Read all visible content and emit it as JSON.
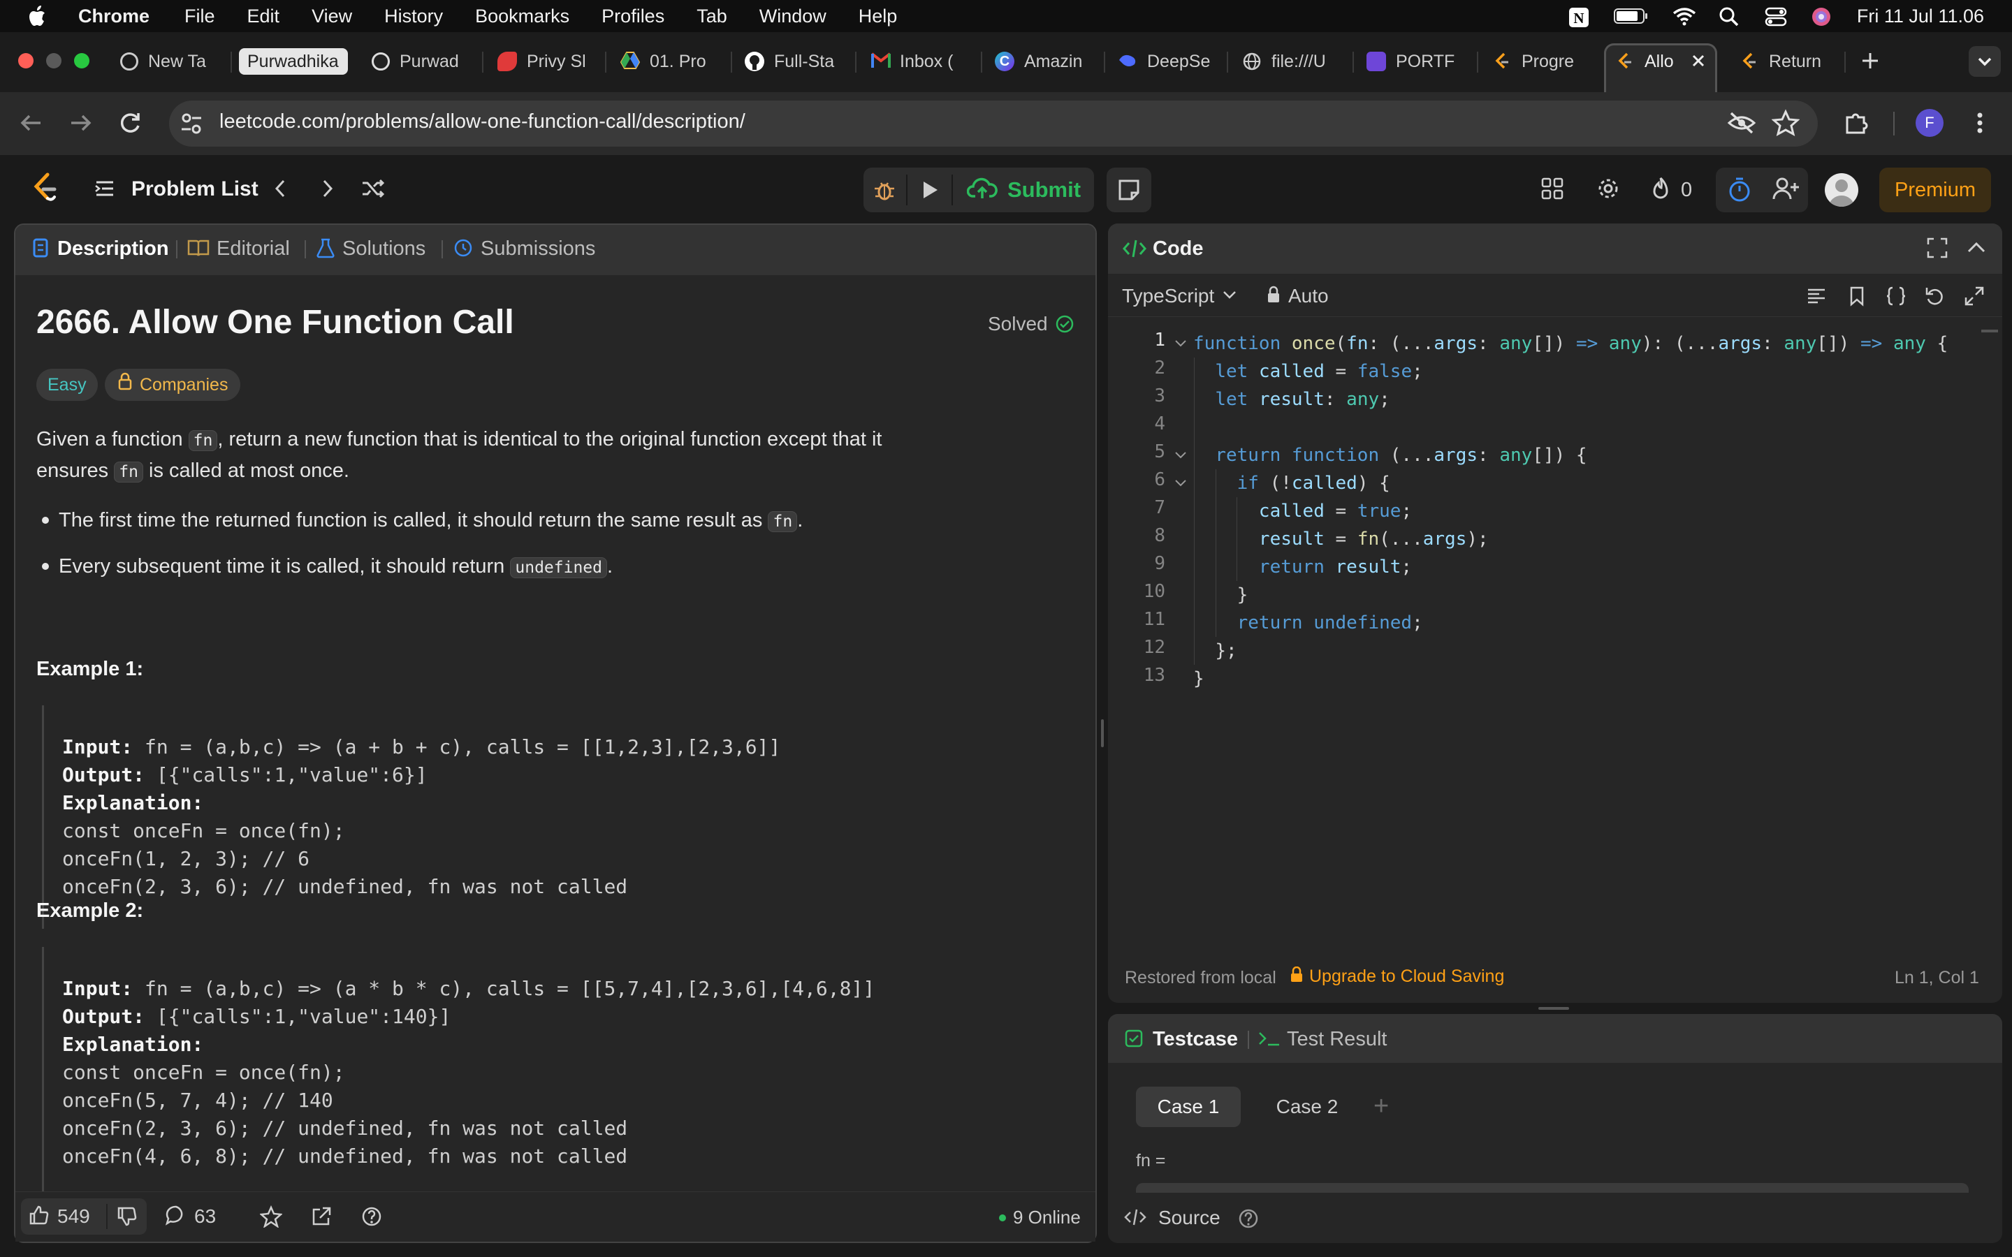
{
  "menubar": {
    "app_name": "Chrome",
    "items": [
      "File",
      "Edit",
      "View",
      "History",
      "Bookmarks",
      "Profiles",
      "Tab",
      "Window",
      "Help"
    ],
    "datetime": "Fri 11 Jul  11.06"
  },
  "tabs": [
    {
      "label": "New Ta",
      "icon": "chrome-icon"
    },
    {
      "label": "Purwadhika",
      "icon": "tab-group-chip"
    },
    {
      "label": "Purwad",
      "icon": "purwadhika-icon"
    },
    {
      "label": "Privy Sl",
      "icon": "privy-icon"
    },
    {
      "label": "01. Pro",
      "icon": "drive-icon"
    },
    {
      "label": "Full-Sta",
      "icon": "github-icon"
    },
    {
      "label": "Inbox (",
      "icon": "gmail-icon"
    },
    {
      "label": "Amazin",
      "icon": "canva-icon"
    },
    {
      "label": "DeepSe",
      "icon": "deepseek-icon"
    },
    {
      "label": "file:///U",
      "icon": "globe-icon"
    },
    {
      "label": "PORTF",
      "icon": "portfolio-icon"
    },
    {
      "label": "Progre",
      "icon": "leetcode-icon"
    },
    {
      "label": "Allo",
      "icon": "leetcode-icon"
    },
    {
      "label": "Return",
      "icon": "leetcode-icon"
    }
  ],
  "address": {
    "url": "leetcode.com/problems/allow-one-function-call/description/",
    "profile_initial": "F"
  },
  "lc_header": {
    "problem_list": "Problem List",
    "submit": "Submit",
    "streak": "0",
    "premium": "Premium"
  },
  "left_panel": {
    "tabs": [
      "Description",
      "Editorial",
      "Solutions",
      "Submissions"
    ],
    "title": "2666. Allow One Function Call",
    "status": "Solved",
    "difficulty": "Easy",
    "companies": "Companies",
    "para1_a": "Given a function ",
    "para1_code": "fn",
    "para1_b": ", return a new function that is identical to the original function except that it",
    "para2_a": "ensures ",
    "para2_code": "fn",
    "para2_b": " is called at most once.",
    "bullet1_a": "The first time the returned function is called, it should return the same result as ",
    "bullet1_code": "fn",
    "bullet1_b": ".",
    "bullet2_a": "Every subsequent time it is called, it should return ",
    "bullet2_code": "undefined",
    "bullet2_b": ".",
    "example1_title": "Example 1:",
    "example1": {
      "input_label": "Input:",
      "input": " fn = (a,b,c) => (a + b + c), calls = [[1,2,3],[2,3,6]]",
      "output_label": "Output:",
      "output": " [{\"calls\":1,\"value\":6}]",
      "explanation_label": "Explanation:",
      "lines": [
        "const onceFn = once(fn);",
        "onceFn(1, 2, 3); // 6",
        "onceFn(2, 3, 6); // undefined, fn was not called"
      ]
    },
    "example2_title": "Example 2:",
    "example2": {
      "input_label": "Input:",
      "input": " fn = (a,b,c) => (a * b * c), calls = [[5,7,4],[2,3,6],[4,6,8]]",
      "output_label": "Output:",
      "output": " [{\"calls\":1,\"value\":140}]",
      "explanation_label": "Explanation:",
      "lines": [
        "const onceFn = once(fn);",
        "onceFn(5, 7, 4); // 140",
        "onceFn(2, 3, 6); // undefined, fn was not called",
        "onceFn(4, 6, 8); // undefined, fn was not called"
      ]
    },
    "footer": {
      "likes": "549",
      "comments": "63",
      "online": "9 Online"
    }
  },
  "code_panel": {
    "title": "Code",
    "language": "TypeScript",
    "mode": "Auto",
    "restored": "Restored from local",
    "upgrade": "Upgrade to Cloud Saving",
    "cursor": "Ln 1, Col 1",
    "line_numbers": [
      "1",
      "2",
      "3",
      "4",
      "5",
      "6",
      "7",
      "8",
      "9",
      "10",
      "11",
      "12",
      "13"
    ]
  },
  "testcase_panel": {
    "tab_testcase": "Testcase",
    "tab_result": "Test Result",
    "case1": "Case 1",
    "case2": "Case 2",
    "add": "+",
    "field_label": "fn =",
    "source": "Source"
  },
  "colors": {
    "accent_green": "#2cbb5d",
    "premium": "#ffa116",
    "easy": "#46c6c2"
  }
}
